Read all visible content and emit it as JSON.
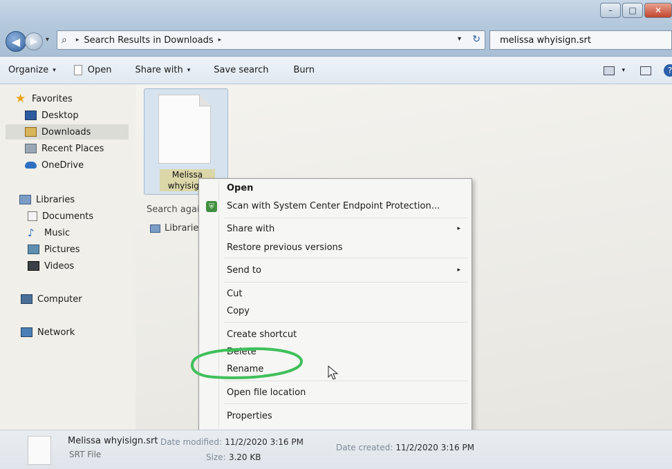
{
  "window": {
    "controls": {
      "minimize": "–",
      "maximize": "□",
      "close": "✕"
    }
  },
  "address": {
    "crumbs": [
      "Search Results in Downloads"
    ],
    "separator": "▸",
    "dropdown": "▾",
    "refresh": "↻"
  },
  "search": {
    "value": "melissa whyisign.srt"
  },
  "toolbar": {
    "organize": "Organize",
    "open": "Open",
    "share_with": "Share with",
    "save_search": "Save search",
    "burn": "Burn",
    "caret": "▾",
    "help": "?"
  },
  "nav": {
    "favorites": "Favorites",
    "desktop": "Desktop",
    "downloads": "Downloads",
    "recent_places": "Recent Places",
    "onedrive": "OneDrive",
    "libraries": "Libraries",
    "documents": "Documents",
    "music": "Music",
    "pictures": "Pictures",
    "videos": "Videos",
    "computer": "Computer",
    "network": "Network"
  },
  "content": {
    "file_name_line1": "Melissa",
    "file_name_line2": "whyisign.",
    "search_again": "Search agair",
    "libraries_link": "Libraries"
  },
  "context_menu": {
    "open": "Open",
    "scan": "Scan with System Center Endpoint Protection...",
    "share_with": "Share with",
    "restore": "Restore previous versions",
    "send_to": "Send to",
    "cut": "Cut",
    "copy": "Copy",
    "create_shortcut": "Create shortcut",
    "delete": "Delete",
    "rename": "Rename",
    "open_location": "Open file location",
    "properties": "Properties",
    "submenu_arrow": "▸"
  },
  "details": {
    "file_name": "Melissa whyisign.srt",
    "file_type": "SRT File",
    "date_modified_label": "Date modified:",
    "date_modified": "11/2/2020 3:16 PM",
    "size_label": "Size:",
    "size": "3.20 KB",
    "date_created_label": "Date created:",
    "date_created": "11/2/2020 3:16 PM"
  },
  "colors": {
    "annotation_green": "#3fbf5a",
    "highlight": "#dcd7a8",
    "selection": "#dcdcd7"
  }
}
